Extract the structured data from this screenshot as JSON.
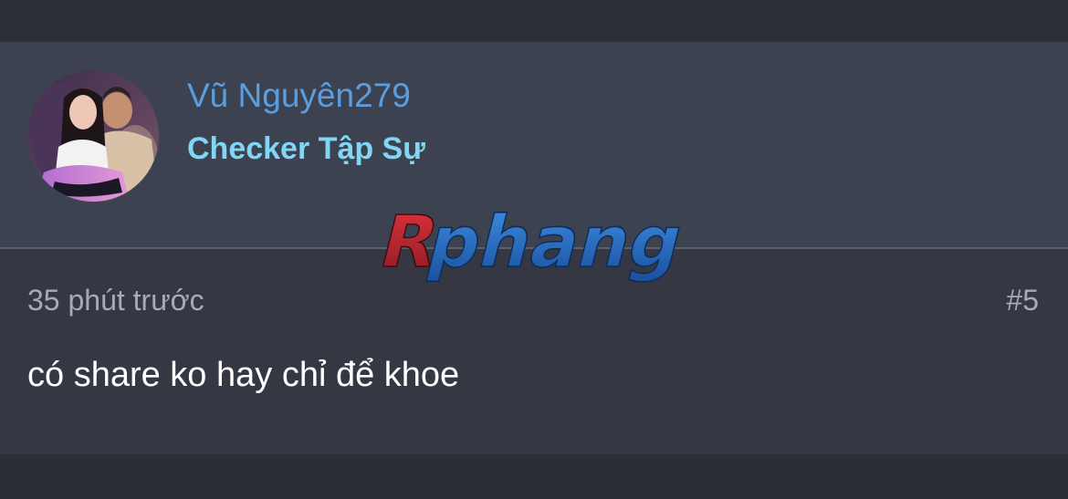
{
  "post": {
    "username": "Vũ Nguyên279",
    "user_title": "Checker Tập Sự",
    "time": "35 phút trước",
    "number": "#5",
    "content": "có share ko hay chỉ để khoe"
  },
  "watermark": {
    "text": "Rphang"
  },
  "colors": {
    "username": "#5b9ee0",
    "user_title": "#7fd6f5",
    "meta_text": "#a7abb4",
    "header_bg": "#3d4250",
    "body_bg": "#353843"
  }
}
